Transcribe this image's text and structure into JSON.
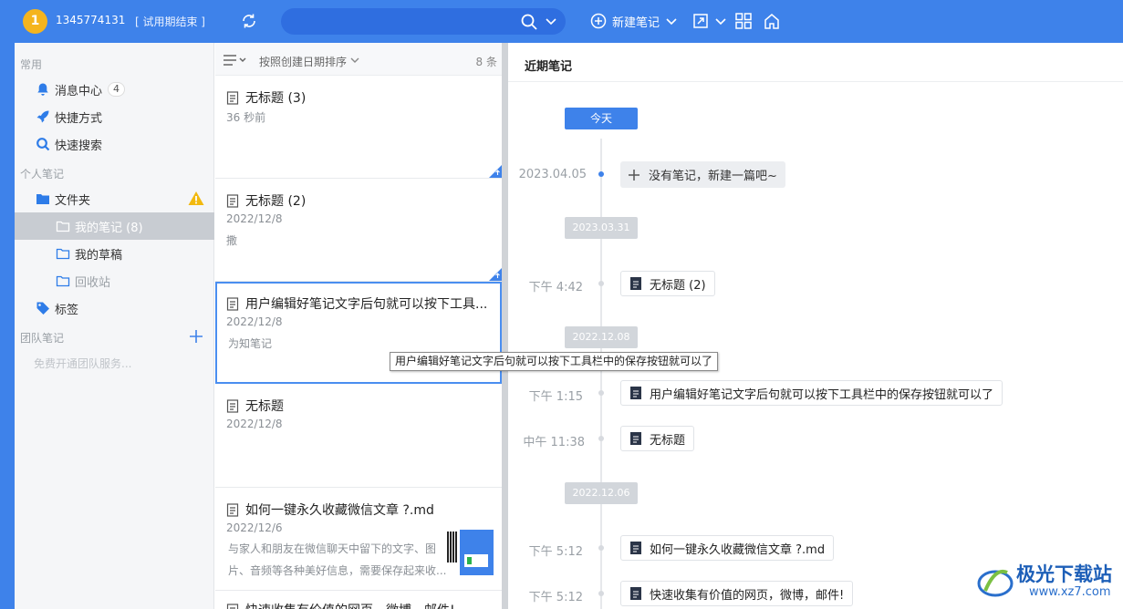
{
  "topbar": {
    "avatar_letter": "1",
    "account": "1345774131",
    "trial_status": "[ 试用期结束 ]",
    "new_note_label": "新建笔记",
    "accent": "#3e82ea"
  },
  "sidebar": {
    "section_common": "常用",
    "messages_label": "消息中心",
    "messages_count": "4",
    "shortcuts_label": "快捷方式",
    "quick_search_label": "快速搜索",
    "section_personal": "个人笔记",
    "folder_label": "文件夹",
    "my_notes_label": "我的笔记 (8)",
    "my_drafts_label": "我的草稿",
    "recycle_label": "回收站",
    "tags_label": "标签",
    "section_team": "团队笔记",
    "team_hint": "免费开通团队服务..."
  },
  "notelist": {
    "sort_label": "按照创建日期排序",
    "count": "8 条",
    "notes": [
      {
        "title": "无标题 (3)",
        "date": "36 秒前",
        "preview": ""
      },
      {
        "title": "无标题 (2)",
        "date": "2022/12/8",
        "preview": "撒"
      },
      {
        "title": "用户编辑好笔记文字后句就可以按下工具...",
        "date": "2022/12/8",
        "preview": "为知笔记"
      },
      {
        "title": "无标题",
        "date": "2022/12/8",
        "preview": ""
      },
      {
        "title": "如何一键永久收藏微信文章 ?.md",
        "date": "2022/12/6",
        "preview_line1": "与家人和朋友在微信聊天中留下的文字、图",
        "preview_line2": "片、音频等各种美好信息，需要保存起来收..."
      },
      {
        "title": "快速收集有价值的网页，微博，邮件!"
      }
    ]
  },
  "tooltip": "用户编辑好笔记文字后句就可以按下工具栏中的保存按钮就可以了",
  "timeline": {
    "title": "近期笔记",
    "today_label": "今天",
    "empty_time": "2023.04.05",
    "empty_label": "没有笔记，新建一篇吧~",
    "groups": [
      {
        "date": "2023.03.31"
      },
      {
        "date": "2022.12.08"
      },
      {
        "date": "2022.12.06"
      }
    ],
    "entries": [
      {
        "time": "下午 4:42",
        "title": "无标题 (2)"
      },
      {
        "time": "下午 1:15",
        "title": "用户编辑好笔记文字后句就可以按下工具栏中的保存按钮就可以了"
      },
      {
        "time": "中午 11:38",
        "title": "无标题"
      },
      {
        "time": "下午 5:12",
        "title": "如何一键永久收藏微信文章 ?.md"
      },
      {
        "time": "下午 5:12",
        "title": "快速收集有价值的网页，微博，邮件!"
      }
    ]
  },
  "watermark": {
    "line1": "极光下载站",
    "line2": "www.xz7.com"
  }
}
